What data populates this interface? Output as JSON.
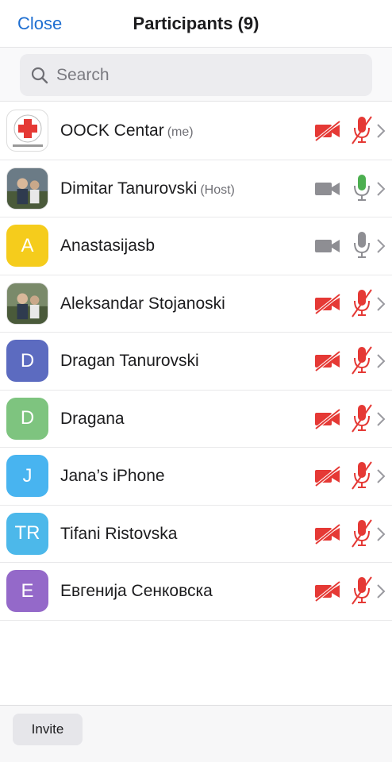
{
  "header": {
    "close_label": "Close",
    "title": "Participants (9)"
  },
  "search": {
    "placeholder": "Search",
    "value": ""
  },
  "participants": [
    {
      "name": "OOCK Centar",
      "tag": "(me)",
      "avatar_type": "logo",
      "avatar_text": "",
      "avatar_color": "#ffffff",
      "video": "off",
      "audio": "muted"
    },
    {
      "name": "Dimitar Tanurovski",
      "tag": "(Host)",
      "avatar_type": "photo",
      "avatar_text": "",
      "avatar_color": "#6b7b86",
      "video": "off-gray",
      "audio": "active"
    },
    {
      "name": "Anastasijasb",
      "tag": "",
      "avatar_type": "letter",
      "avatar_text": "A",
      "avatar_color": "#f5cc1c",
      "video": "off-gray",
      "audio": "idle"
    },
    {
      "name": "Aleksandar Stojanoski",
      "tag": "",
      "avatar_type": "photo",
      "avatar_text": "",
      "avatar_color": "#7a8a6a",
      "video": "off",
      "audio": "muted"
    },
    {
      "name": "Dragan Tanurovski",
      "tag": "",
      "avatar_type": "letter",
      "avatar_text": "D",
      "avatar_color": "#5c6bc0",
      "video": "off",
      "audio": "muted"
    },
    {
      "name": "Dragana",
      "tag": "",
      "avatar_type": "letter",
      "avatar_text": "D",
      "avatar_color": "#7ec47f",
      "video": "off",
      "audio": "muted"
    },
    {
      "name": "Jana’s iPhone",
      "tag": "",
      "avatar_type": "letter",
      "avatar_text": "J",
      "avatar_color": "#48b4f0",
      "video": "off",
      "audio": "muted"
    },
    {
      "name": "Tifani Ristovska",
      "tag": "",
      "avatar_type": "letter",
      "avatar_text": "TR",
      "avatar_color": "#4cb8ea",
      "video": "off",
      "audio": "muted"
    },
    {
      "name": "Евгенија Сенковска",
      "tag": "",
      "avatar_type": "letter",
      "avatar_text": "Е",
      "avatar_color": "#9469c9",
      "video": "off",
      "audio": "muted"
    }
  ],
  "icons": {
    "video_off": "video-off-icon",
    "mic_muted": "mic-muted-icon",
    "mic_active": "mic-active-icon",
    "chevron": "chevron-right-icon"
  },
  "colors": {
    "accent": "#1f6fd1",
    "muted_red": "#e53935",
    "active_green": "#4caf50",
    "gray_icon": "#8e8e93"
  },
  "footer": {
    "invite_label": "Invite"
  }
}
